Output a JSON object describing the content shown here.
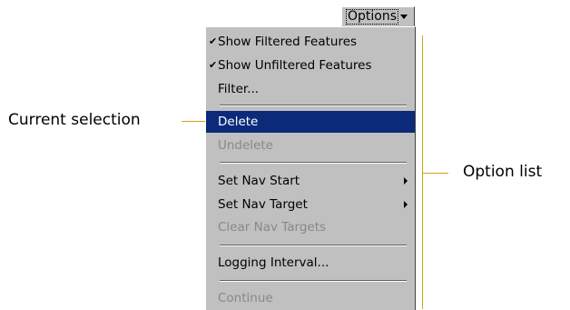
{
  "options_button": {
    "label": "Options"
  },
  "menu": {
    "items": [
      {
        "label": "Show Filtered Features",
        "checked": true,
        "enabled": true
      },
      {
        "label": "Show Unfiltered Features",
        "checked": true,
        "enabled": true
      },
      {
        "label": "Filter...",
        "checked": false,
        "enabled": true
      },
      {
        "label": "Delete",
        "checked": false,
        "enabled": true,
        "selected": true
      },
      {
        "label": "Undelete",
        "checked": false,
        "enabled": false
      },
      {
        "label": "Set Nav Start",
        "checked": false,
        "enabled": true,
        "submenu": true
      },
      {
        "label": "Set Nav Target",
        "checked": false,
        "enabled": true,
        "submenu": true
      },
      {
        "label": "Clear Nav Targets",
        "checked": false,
        "enabled": false
      },
      {
        "label": "Logging Interval...",
        "checked": false,
        "enabled": true
      },
      {
        "label": "Continue",
        "checked": false,
        "enabled": false
      }
    ],
    "check_glyph": "✔"
  },
  "annotations": {
    "current_selection": "Current selection",
    "option_list": "Option list"
  },
  "colors": {
    "menu_background": "#c0c0c0",
    "selection_background": "#0c2a7a",
    "disabled_text": "#888888",
    "annotation_line": "#d4a017"
  },
  "icons": {
    "check": "check-icon",
    "submenu": "submenu-arrow-icon",
    "dropdown": "chevron-down-icon"
  }
}
